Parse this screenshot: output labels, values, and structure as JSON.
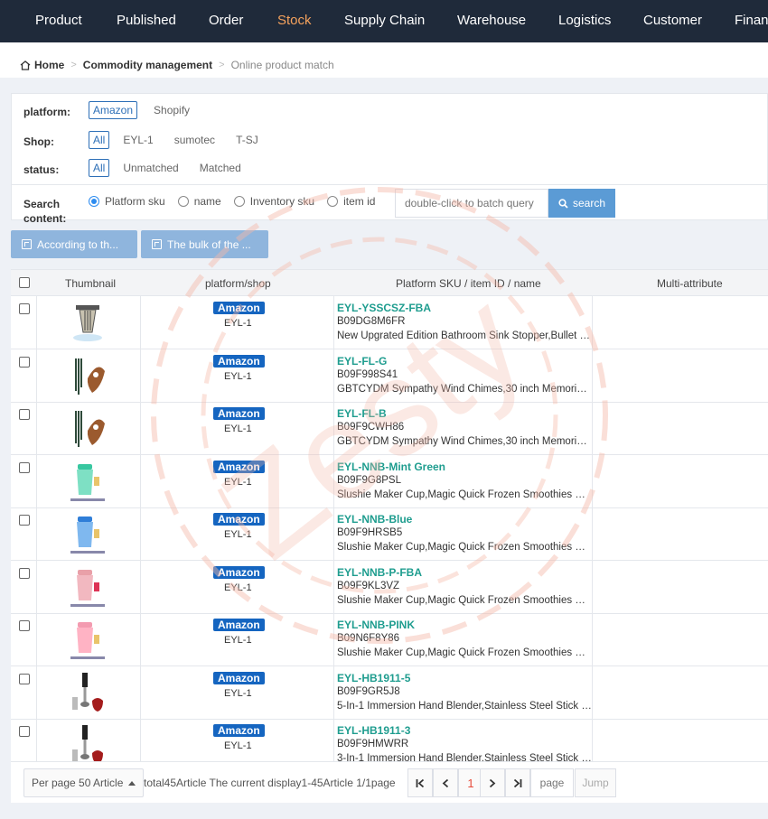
{
  "nav": [
    {
      "label": "Product"
    },
    {
      "label": "Published"
    },
    {
      "label": "Order"
    },
    {
      "label": "Stock",
      "active": true
    },
    {
      "label": "Supply Chain"
    },
    {
      "label": "Warehouse"
    },
    {
      "label": "Logistics"
    },
    {
      "label": "Customer"
    },
    {
      "label": "Finan"
    }
  ],
  "breadcrumb": {
    "home": "Home",
    "level2": "Commodity management",
    "current": "Online product match"
  },
  "filters": {
    "platform": {
      "label": "platform:",
      "options": [
        "Amazon",
        "Shopify"
      ],
      "selected": "Amazon"
    },
    "shop": {
      "label": "Shop:",
      "options": [
        "All",
        "EYL-1",
        "sumotec",
        "T-SJ"
      ],
      "selected": "All"
    },
    "status": {
      "label": "status:",
      "options": [
        "All",
        "Unmatched",
        "Matched"
      ],
      "selected": "All"
    },
    "search": {
      "label": "Search content:",
      "radios": [
        "Platform sku",
        "name",
        "Inventory sku",
        "item id"
      ],
      "selected": "Platform sku",
      "placeholder": "double-click to batch query",
      "button": "search"
    }
  },
  "actions": {
    "according": "According to th...",
    "bulk": "The bulk of the ..."
  },
  "table": {
    "headers": {
      "thumbnail": "Thumbnail",
      "platform_shop": "platform/shop",
      "sku": "Platform SKU / item ID / name",
      "multi": "Multi-attribute"
    },
    "rows": [
      {
        "platform": "Amazon",
        "shop": "EYL-1",
        "sku": "EYL-YSSCSZ-FBA",
        "item_id": "B09DG8M6FR",
        "name": "New Upgrated Edition Bathroom Sink Stopper,Bullet C...",
        "thumb": "sink-stopper"
      },
      {
        "platform": "Amazon",
        "shop": "EYL-1",
        "sku": "EYL-FL-G",
        "item_id": "B09F998S41",
        "name": "GBTCYDM Sympathy Wind Chimes,30 inch Memorial ...",
        "thumb": "wind-chime"
      },
      {
        "platform": "Amazon",
        "shop": "EYL-1",
        "sku": "EYL-FL-B",
        "item_id": "B09F9CWH86",
        "name": "GBTCYDM Sympathy Wind Chimes,30 inch Memorial ...",
        "thumb": "wind-chime"
      },
      {
        "platform": "Amazon",
        "shop": "EYL-1",
        "sku": "EYL-NNB-Mint Green",
        "item_id": "B09F9G8PSL",
        "name": "Slushie Maker Cup,Magic Quick Frozen Smoothies Cu...",
        "thumb": "cup-green"
      },
      {
        "platform": "Amazon",
        "shop": "EYL-1",
        "sku": "EYL-NNB-Blue",
        "item_id": "B09F9HRSB5",
        "name": "Slushie Maker Cup,Magic Quick Frozen Smoothies Cu...",
        "thumb": "cup-blue"
      },
      {
        "platform": "Amazon",
        "shop": "EYL-1",
        "sku": "EYL-NNB-P-FBA",
        "item_id": "B09F9KL3VZ",
        "name": "Slushie Maker Cup,Magic Quick Frozen Smoothies Cu...",
        "thumb": "cup-pink"
      },
      {
        "platform": "Amazon",
        "shop": "EYL-1",
        "sku": "EYL-NNB-PINK",
        "item_id": "B09N6F8Y86",
        "name": "Slushie Maker Cup,Magic Quick Frozen Smoothies Cu...",
        "thumb": "cup-pink2"
      },
      {
        "platform": "Amazon",
        "shop": "EYL-1",
        "sku": "EYL-HB1911-5",
        "item_id": "B09F9GR5J8",
        "name": "5-In-1 Immersion Hand Blender,Stainless Steel Stick Bl...",
        "thumb": "blender"
      },
      {
        "platform": "Amazon",
        "shop": "EYL-1",
        "sku": "EYL-HB1911-3",
        "item_id": "B09F9HMWRR",
        "name": "3-In-1 Immersion Hand Blender,Stainless Steel Stick Bl...",
        "thumb": "blender"
      }
    ]
  },
  "pager": {
    "per_page": "Per page 50 Article",
    "total_text": "total45Article The current display1-45Article 1/1page",
    "current_page": "1",
    "page_placeholder": "page",
    "jump": "Jump"
  },
  "watermark": "Zesty",
  "colors": {
    "nav_bg": "#1f2a3a",
    "nav_active": "#f5a25d",
    "sku_link": "#1f9d8f",
    "badge": "#1565c0",
    "button": "#5b9bd5"
  }
}
